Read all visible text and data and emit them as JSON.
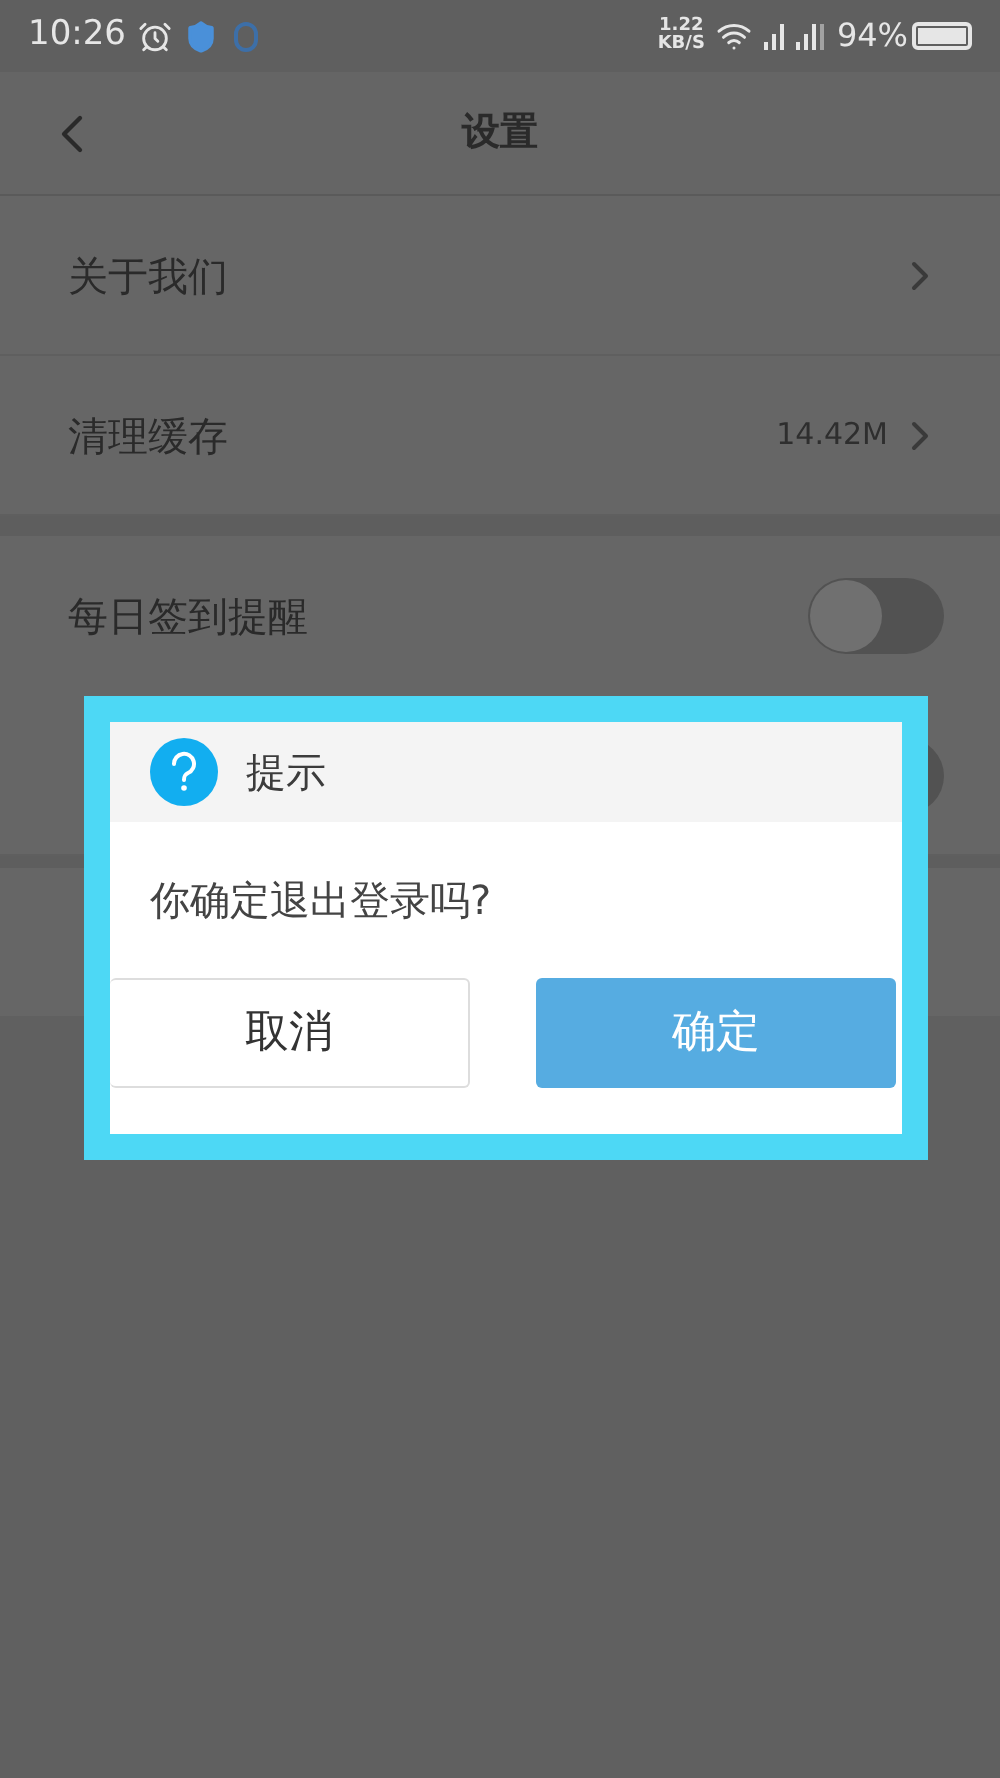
{
  "status_bar": {
    "time": "10:26",
    "speed": "1.22",
    "speed_unit": "KB/S",
    "battery": "94%"
  },
  "header": {
    "title": "设置"
  },
  "rows": [
    {
      "kind": "link",
      "label": "关于我们"
    },
    {
      "kind": "value",
      "label": "清理缓存",
      "value": "14.42M"
    },
    {
      "kind": "toggle",
      "label": "每日签到提醒",
      "on": false
    },
    {
      "kind": "toggle",
      "on": false
    }
  ],
  "dialog": {
    "title": "提示",
    "message": "你确定退出登录吗?",
    "buttons": [
      {
        "label": "取消",
        "primary": false
      },
      {
        "label": "确定",
        "primary": true
      }
    ]
  }
}
